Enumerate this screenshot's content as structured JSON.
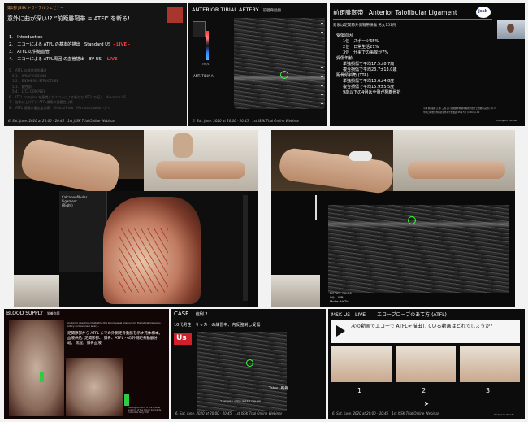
{
  "p1": {
    "header_small": "第1部 JSSK トライアルウェビナー",
    "title": "意外に曲が深い!? “前距腓靭帯 = ATFL” を斬る!",
    "items": [
      {
        "text": "1.　Introduction",
        "live": ""
      },
      {
        "text": "2.　エコーによる ATFL の基本的描出　Standard US",
        "live": "- LIVE -"
      },
      {
        "text": "3.　ATFL の供給血管",
        "live": ""
      },
      {
        "text": "4.　エコーによる ATFL周囲 の血管描出　BV US",
        "live": "- LIVE -"
      }
    ],
    "dim_items": [
      "5.　ATFL の解剖学的構造",
      "　5-1.　WRAP AROUND",
      "　5-2.　ENTHESIS STRUCTURE",
      "　5-3.　腱性部",
      "　5-4.　LTCL COMPLEX",
      "6.　LTCL complex を意識したエコーによる新たな ATFL の捉え　Advance US",
      "7.　従来に上げ下げ ATFL損傷の重要性分類",
      "8.　ATFL 損傷の重症度分類　Clinical Flow　Microcirculation 小へ"
    ],
    "footer": "6. Sat. June. 2020 at 20:00 - 20:45　1st JSSK Trial Online Webinar"
  },
  "p2": {
    "title": "ANTERIOR TIBIAL ARTERY",
    "title_jp": "前脛骨動脈",
    "label": "ANT. TIBIA A.",
    "scale_label": "cm/s",
    "footer": "6. Sat. June. 2020 at 20:00 - 20:45　1st JSSK Trial Online Webinar"
  },
  "p3": {
    "title_jp": "前距腓靭帯",
    "title_en": "Anterior Talofibular Ligament",
    "logo": "jssk",
    "subtitle": "対象は足関節外側靱帯損傷 男女151例",
    "sections": [
      {
        "heading": "受傷原因",
        "lines": [
          "1位　スポーツ65%",
          "2位　日常生活21%",
          "3位　仕事での事故が7%"
        ]
      },
      {
        "heading": "受傷年齢",
        "lines": [
          "単独損傷で平均17.5±8.7歳",
          "複合損傷で平均23.7±13.0歳"
        ]
      },
      {
        "heading": "距骨傾斜角 (TTA)",
        "lines": [
          "単独損傷で平均13.6±4.8度",
          "複合損傷で平均15.9±5.5度",
          "9歳以下の4例は全例が裂離骨折"
        ]
      }
    ],
    "ref_line1": "小林 勝, 福井 正博, 三谷 誠: 足関節外側靱帯損傷の統計と治療の実際について",
    "ref_line2": "中部日本整形外科災害外科学会雑誌 45巻 5号 (1002) p.10",
    "presenter": "Yoshiyuki Yokota"
  },
  "p4": {
    "name": "live-dissection-video"
  },
  "p5": {
    "name": "live-ultrasound-video",
    "overlay": "BG:20　DR:65\nWJ:　WB:\nMode: HaTH:"
  },
  "p6": {
    "title": "BLOOD SUPPLY",
    "title_jp": "栄養血管",
    "caption_en": "Anatomic specimen illustrating the blood vessel arising from the lateral malleolus artery and peroneal artery...",
    "text_jp": "足関節部から ATFL までの外側距骨動脈を示す死体標本。\n血液供給: 足関節部、\n腓骨、ATFL への外側距骨動脈分岐。\n黒星。腓骨血液",
    "ref": "Histological study of the arterial anatomy of the lateral ligaments. Foot Ankle Surg 2016"
  },
  "p7": {
    "case": "CASE",
    "case_jp": "症例 2",
    "logo": "Us",
    "patient": "10代男性　サッカーの練習中、内反強制し受傷",
    "label_talus": "Talus",
    "label_talus_jp": "距骨",
    "caption": "7 HOUR LATER INTER INJURY",
    "footer": "6. Sat. June. 2020 at 20:00 - 20:45　1st JSSK Trial Online Webinar"
  },
  "p8": {
    "title": "MSK US - LIVE -",
    "title_jp": "エコープローブのあて方 (ATFL)",
    "question": "次の動画でエコーで ATFLを描出している動画はどれでしょうか？",
    "choices": [
      "1",
      "2",
      "3"
    ],
    "footer": "6. Sat. June. 2020 at 20:00 - 20:45　1st JSSK Trial Online Webinar",
    "presenter": "Yoshiyuki Yokota"
  }
}
